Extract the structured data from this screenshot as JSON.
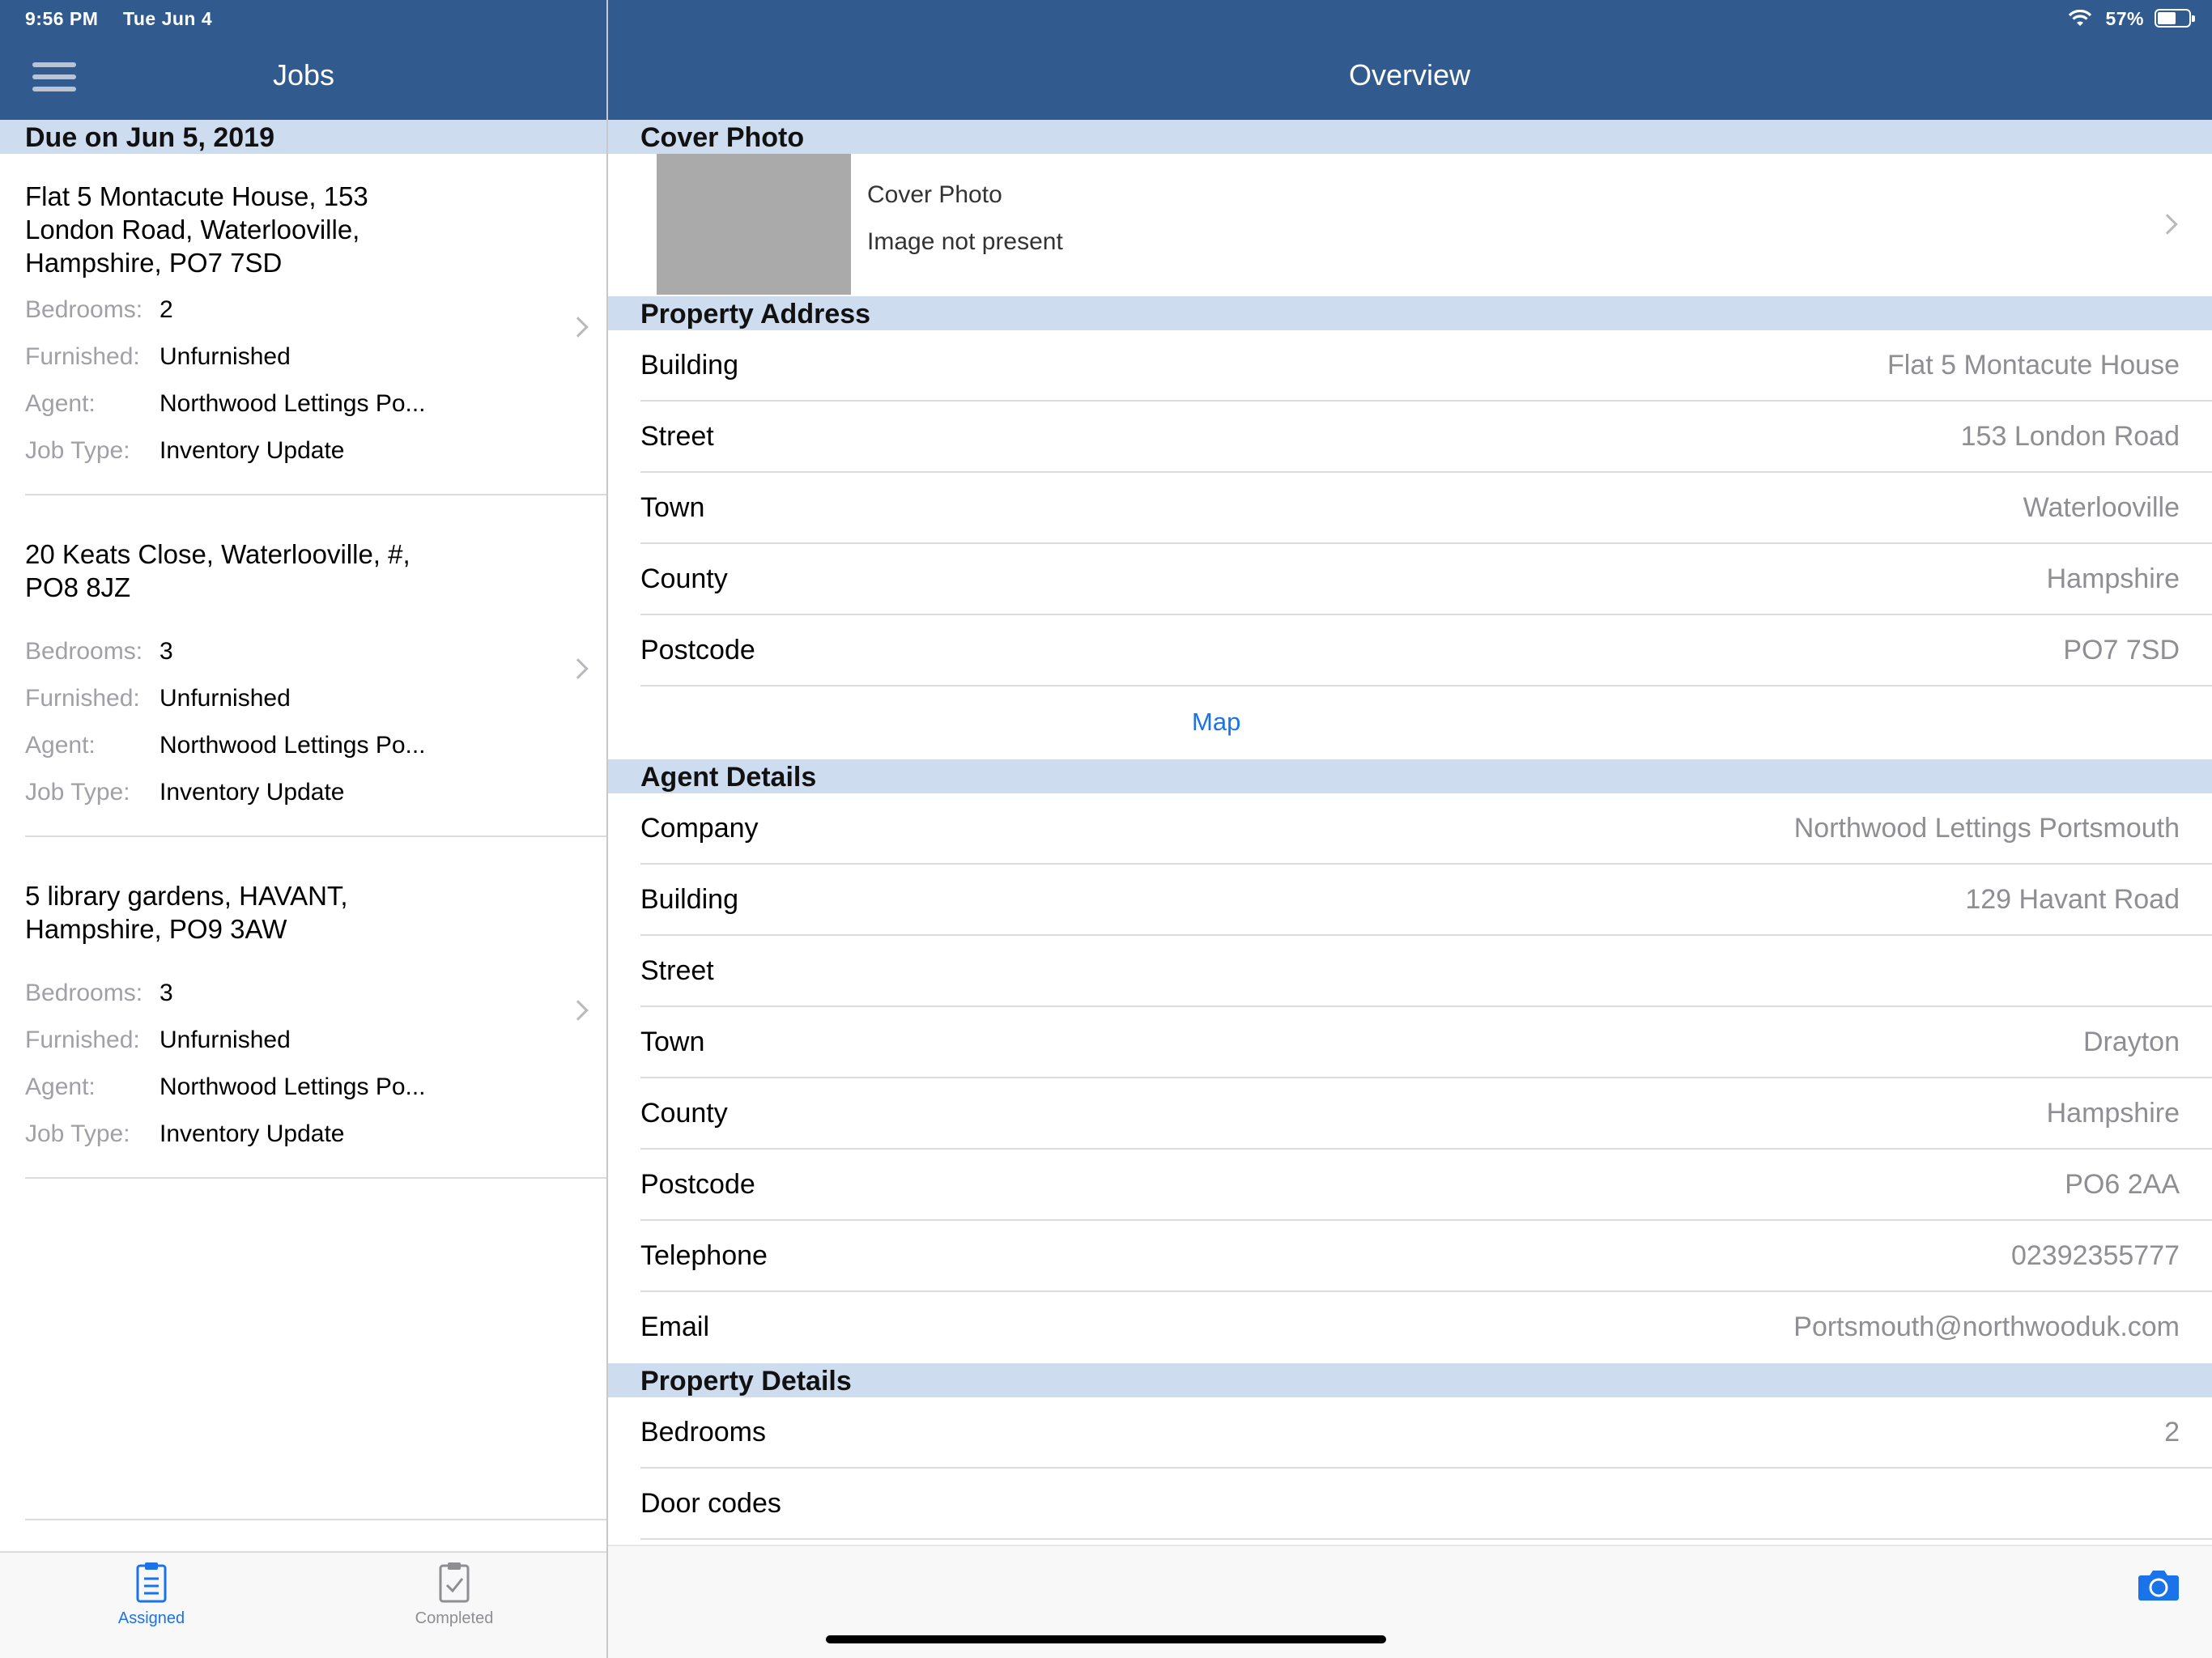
{
  "status_bar": {
    "time": "9:56 PM",
    "date": "Tue Jun 4",
    "battery": "57%"
  },
  "left": {
    "title": "Jobs",
    "section": "Due on Jun 5, 2019",
    "jobs": [
      {
        "address": "Flat 5 Montacute House, 153 London Road, Waterlooville, Hampshire, PO7 7SD",
        "bedrooms_label": "Bedrooms:",
        "bedrooms": "2",
        "furnished_label": "Furnished:",
        "furnished": "Unfurnished",
        "agent_label": "Agent:",
        "agent": "Northwood Lettings Po...",
        "jobtype_label": "Job Type:",
        "jobtype": "Inventory Update"
      },
      {
        "address": "20 Keats Close, Waterlooville, #, PO8 8JZ",
        "bedrooms_label": "Bedrooms:",
        "bedrooms": "3",
        "furnished_label": "Furnished:",
        "furnished": "Unfurnished",
        "agent_label": "Agent:",
        "agent": "Northwood Lettings Po...",
        "jobtype_label": "Job Type:",
        "jobtype": "Inventory Update"
      },
      {
        "address": "5 library gardens, HAVANT, Hampshire, PO9 3AW",
        "bedrooms_label": "Bedrooms:",
        "bedrooms": "3",
        "furnished_label": "Furnished:",
        "furnished": "Unfurnished",
        "agent_label": "Agent:",
        "agent": "Northwood Lettings Po...",
        "jobtype_label": "Job Type:",
        "jobtype": "Inventory Update"
      }
    ]
  },
  "tabs": {
    "assigned": "Assigned",
    "completed": "Completed"
  },
  "right": {
    "title": "Overview",
    "cover": {
      "header": "Cover Photo",
      "label": "Cover Photo",
      "status": "Image not present"
    },
    "property_address": {
      "header": "Property Address",
      "rows": [
        {
          "k": "Building",
          "v": "Flat 5 Montacute House"
        },
        {
          "k": "Street",
          "v": "153 London Road"
        },
        {
          "k": "Town",
          "v": "Waterlooville"
        },
        {
          "k": "County",
          "v": "Hampshire"
        },
        {
          "k": "Postcode",
          "v": "PO7 7SD"
        }
      ],
      "map_link": "Map"
    },
    "agent_details": {
      "header": "Agent Details",
      "rows": [
        {
          "k": "Company",
          "v": "Northwood Lettings Portsmouth"
        },
        {
          "k": "Building",
          "v": "129 Havant Road"
        },
        {
          "k": "Street",
          "v": ""
        },
        {
          "k": "Town",
          "v": "Drayton"
        },
        {
          "k": "County",
          "v": "Hampshire"
        },
        {
          "k": "Postcode",
          "v": "PO6 2AA"
        },
        {
          "k": "Telephone",
          "v": "02392355777"
        },
        {
          "k": "Email",
          "v": "Portsmouth@northwooduk.com"
        }
      ]
    },
    "property_details": {
      "header": "Property Details",
      "rows": [
        {
          "k": "Bedrooms",
          "v": "2"
        },
        {
          "k": "Door codes",
          "v": ""
        }
      ]
    }
  },
  "colors": {
    "nav_bar": "#315b8e",
    "section_header": "#cedcf0",
    "accent": "#1a73e8"
  },
  "icons": {
    "menu": "hamburger-icon",
    "wifi": "wifi-icon",
    "battery": "battery-icon",
    "assigned": "clipboard-icon",
    "completed": "clipboard-check-icon",
    "camera": "camera-icon"
  }
}
